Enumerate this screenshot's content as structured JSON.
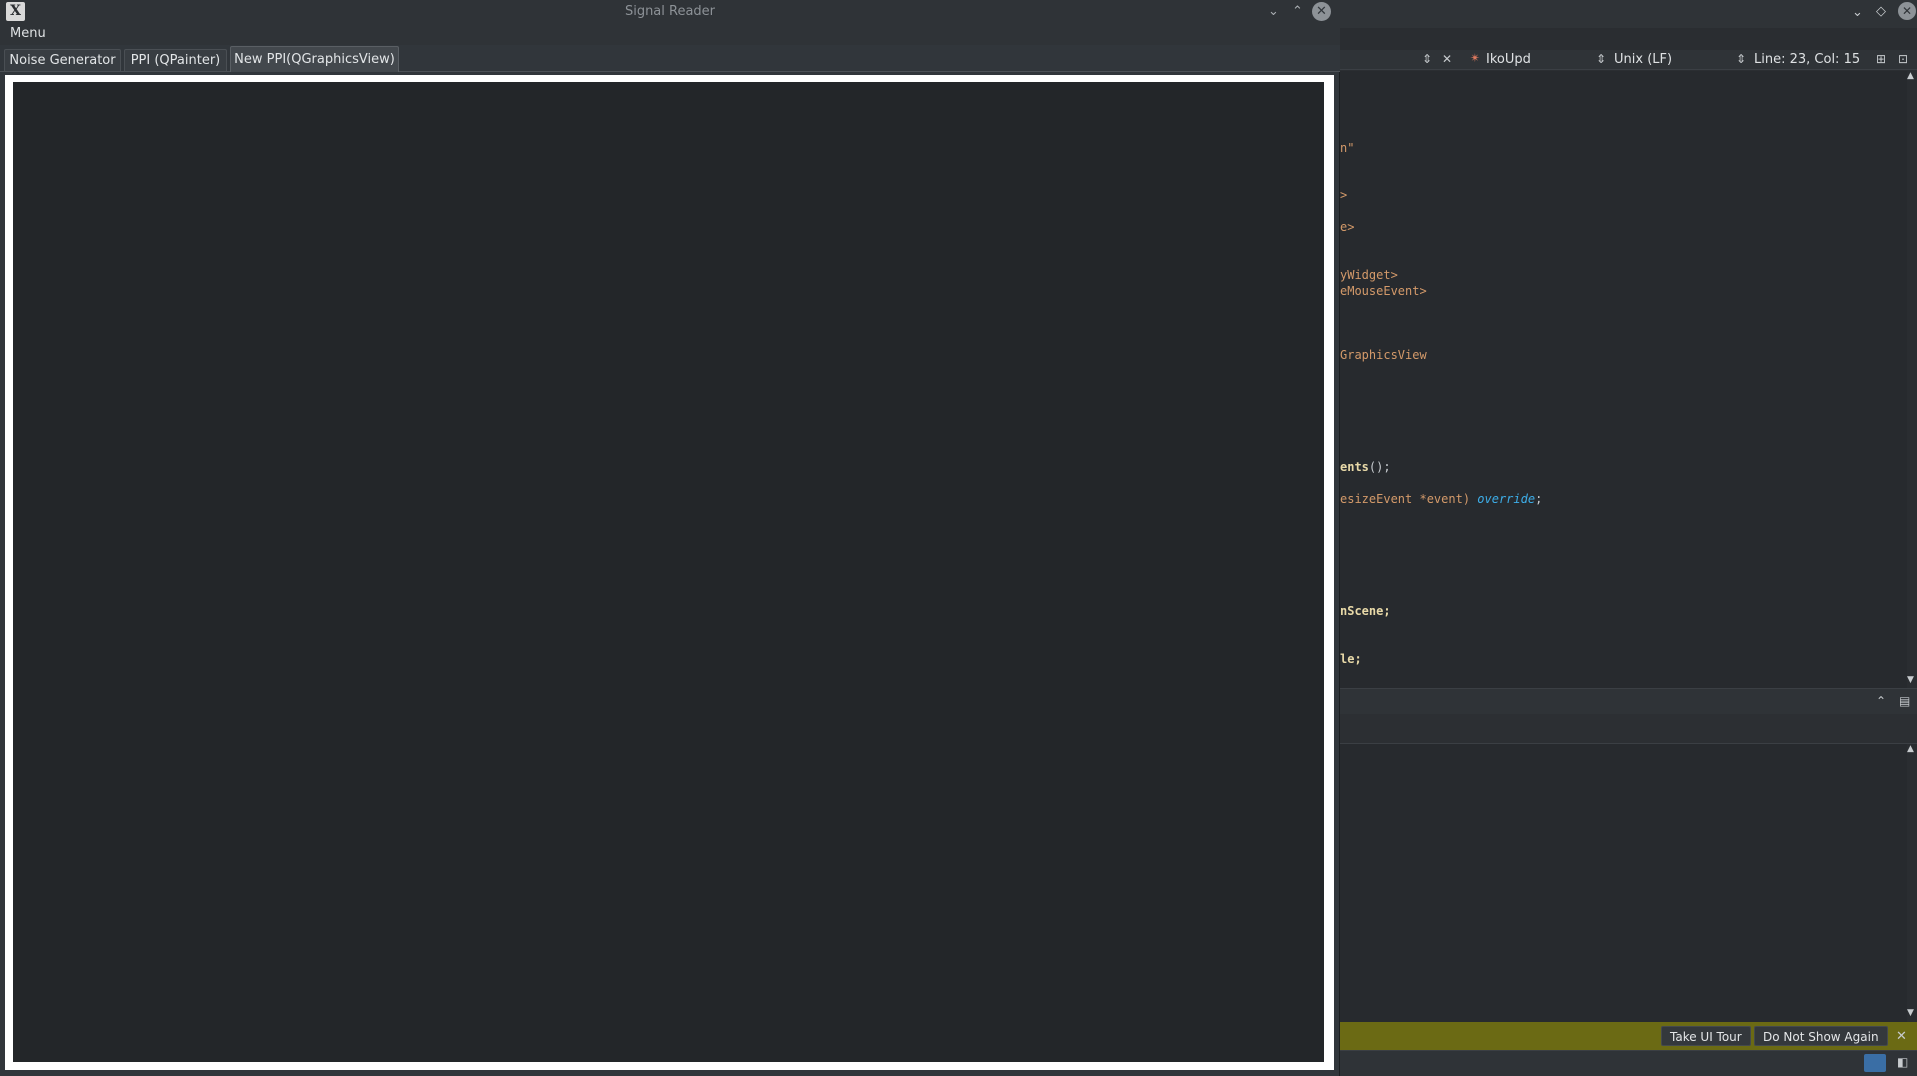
{
  "ide": {
    "toolbar": {
      "symbol_combo": "IkoUpd",
      "line_endings": "Unix (LF)",
      "cursor_position": "Line: 23, Col: 15"
    },
    "code_fragments": [
      {
        "text": "n\"",
        "cls": "c-str"
      },
      {
        "text": ">",
        "cls": "c-str"
      },
      {
        "text": "e>",
        "cls": "c-str"
      },
      {
        "text": "yWidget>",
        "cls": "c-str"
      },
      {
        "text": "eMouseEvent>",
        "cls": "c-str"
      },
      {
        "text": "GraphicsView",
        "cls": "c-str"
      },
      {
        "text": "ents",
        "cls": "c-fn",
        "rest": "();"
      },
      {
        "text": "esizeEvent *event) ",
        "cls": "c-str",
        "kw": "override",
        "rest": ";"
      },
      {
        "text": "nScene;",
        "cls": "c-fn"
      },
      {
        "text": "le;",
        "cls": "c-fn"
      }
    ],
    "infobar": {
      "take_tour": "Take UI Tour",
      "dont_show": "Do Not Show Again"
    },
    "icons": [
      "chevron-down-icon",
      "restore-icon",
      "close-icon",
      "split-icon",
      "close-document-icon",
      "collapse-icon",
      "maximize-panel-icon"
    ]
  },
  "app": {
    "title": "Signal Reader",
    "menu": "Menu",
    "tabs": [
      {
        "label": "Noise Generator",
        "active": false
      },
      {
        "label": "PPI (QPainter)",
        "active": false
      },
      {
        "label": "New PPI(QGraphicsView)",
        "active": true
      }
    ],
    "colors": {
      "window_bg": "#31363b",
      "view_border": "#ffffff",
      "view_bg": "#232629",
      "infobar_bg": "#6b6a14"
    }
  }
}
